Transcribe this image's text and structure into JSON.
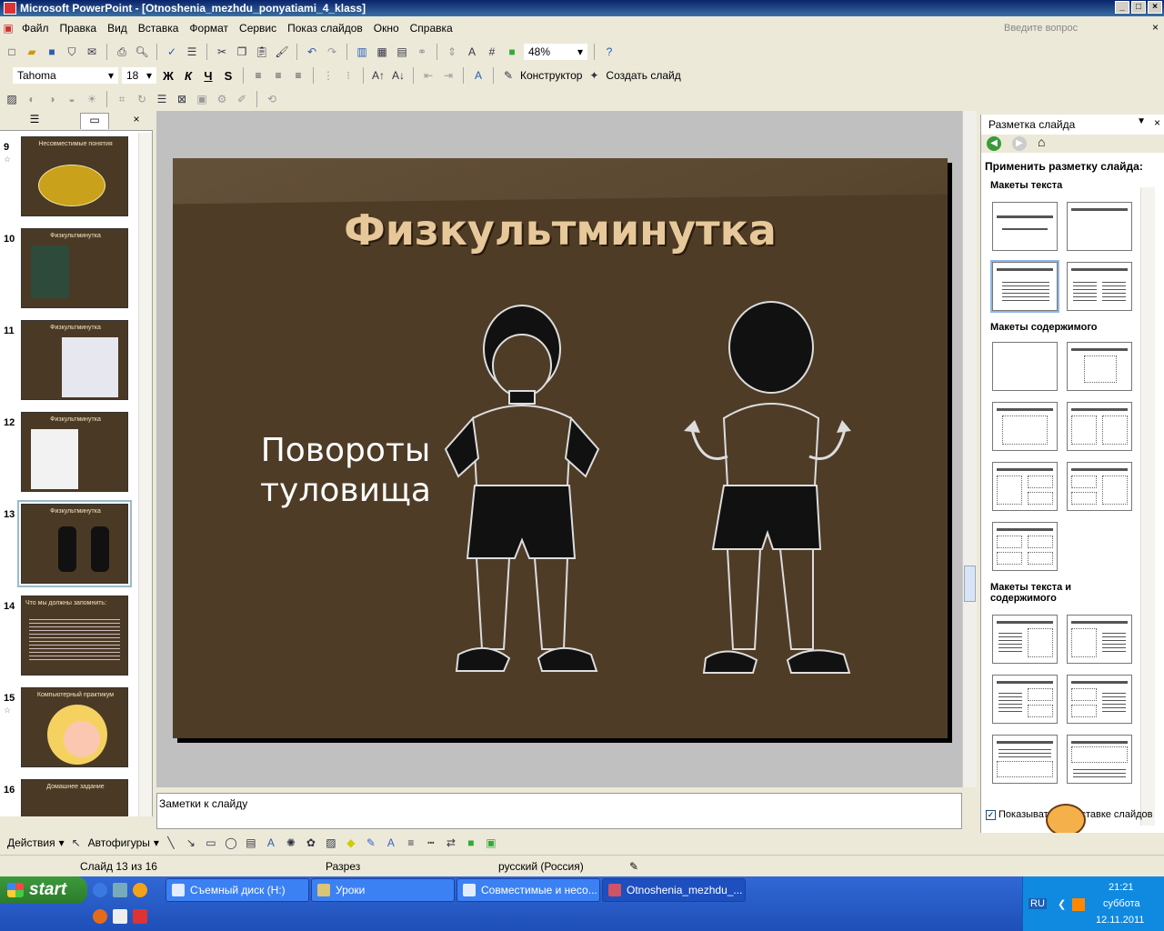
{
  "window": {
    "title": "Microsoft PowerPoint - [Otnoshenia_mezhdu_ponyatiami_4_klass]"
  },
  "menu": {
    "items": [
      "Файл",
      "Правка",
      "Вид",
      "Вставка",
      "Формат",
      "Сервис",
      "Показ слайдов",
      "Окно",
      "Справка"
    ],
    "help_placeholder": "Введите вопрос"
  },
  "toolbar": {
    "zoom": "48%",
    "font_name": "Tahoma",
    "font_size": "18",
    "bold": "Ж",
    "italic": "К",
    "underline": "Ч",
    "shadow": "S",
    "designer": "Конструктор",
    "new_slide": "Создать слайд"
  },
  "slides_panel": {
    "thumbnails": [
      {
        "number": "9",
        "title": "Несовместимые понятия"
      },
      {
        "number": "10",
        "title": "Физкультминутка"
      },
      {
        "number": "11",
        "title": "Физкультминутка"
      },
      {
        "number": "12",
        "title": "Физкультминутка"
      },
      {
        "number": "13",
        "title": "Физкультминутка"
      },
      {
        "number": "14",
        "title": "Что мы должны запомнить:"
      },
      {
        "number": "15",
        "title": "Компьютерный практикум"
      },
      {
        "number": "16",
        "title": "Домашнее задание"
      }
    ]
  },
  "slide": {
    "title": "Физкультминутка",
    "body_line1": "Повороты",
    "body_line2": "туловища"
  },
  "notes": {
    "placeholder": "Заметки к слайду"
  },
  "task_pane": {
    "title": "Разметка слайда",
    "apply_label": "Применить разметку слайда:",
    "section_text": "Макеты текста",
    "section_content": "Макеты содержимого",
    "section_text_content": "Макеты текста и содержимого",
    "show_checkbox": "Показывать при вставке слайдов"
  },
  "draw_toolbar": {
    "actions": "Действия",
    "autoshapes": "Автофигуры"
  },
  "status": {
    "slide": "Слайд 13 из 16",
    "design": "Разрез",
    "language": "русский (Россия)"
  },
  "taskbar": {
    "start": "start",
    "tasks": [
      "Съемный диск (H:)",
      "Уроки",
      "Совместимые и несо...",
      "Otnoshenia_mezhdu_..."
    ],
    "lang": "RU",
    "time": "21:21",
    "day": "суббота",
    "date": "12.11.2011"
  },
  "colors": {
    "slide_background": "#4e3c27",
    "title_color": "#e7c89a",
    "titlebar": "#0A246A",
    "taskbar": "#245edb"
  }
}
